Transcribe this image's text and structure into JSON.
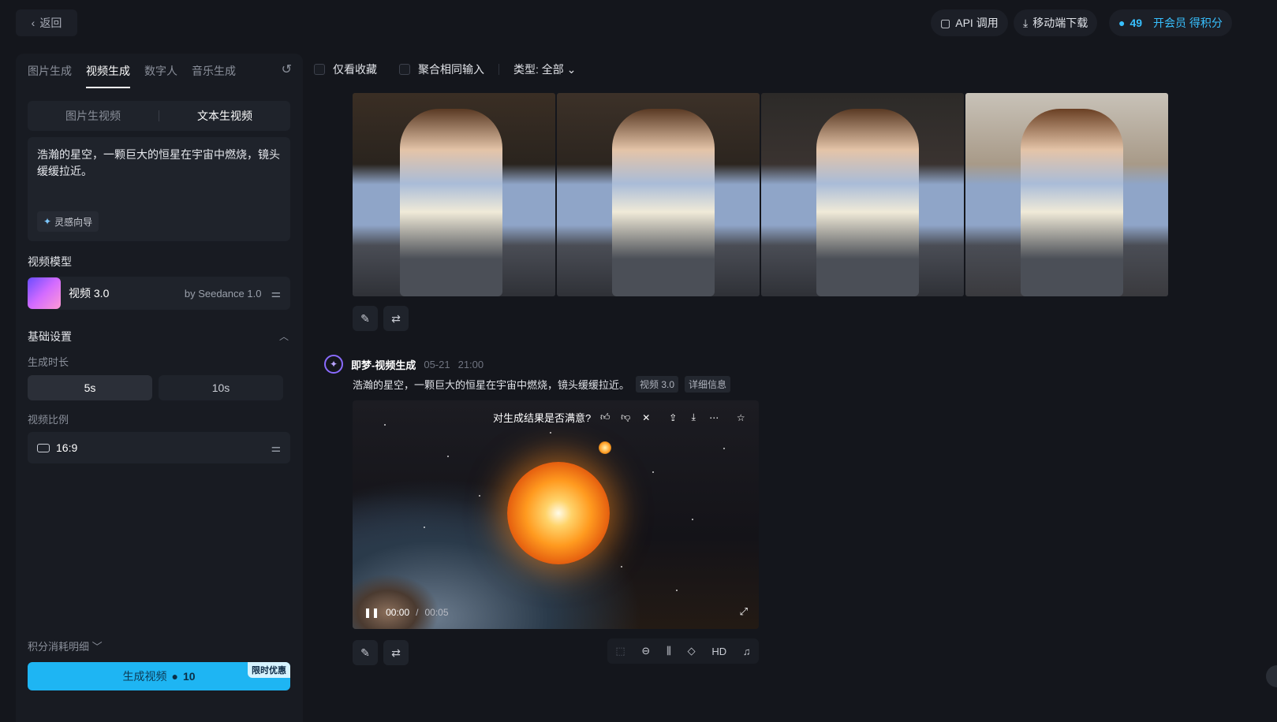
{
  "topbar": {
    "back_label": "返回",
    "api_label": "API 调用",
    "mobile_label": "移动端下载",
    "credits": "49",
    "vip_label": "开会员 得积分"
  },
  "left": {
    "tabs": [
      {
        "label": "图片生成"
      },
      {
        "label": "视频生成",
        "active": true
      },
      {
        "label": "数字人"
      },
      {
        "label": "音乐生成"
      }
    ],
    "mode": {
      "image_to_video": "图片生视频",
      "text_to_video": "文本生视频"
    },
    "prompt": "浩瀚的星空，一颗巨大的恒星在宇宙中燃烧，镜头缓缓拉近。",
    "inspire_label": "灵感向导",
    "model_section": "视频模型",
    "model_name": "视频 3.0",
    "model_by": "by Seedance 1.0",
    "basic_settings": "基础设置",
    "duration_label": "生成时长",
    "durations": [
      "5s",
      "10s"
    ],
    "ratio_label": "视频比例",
    "ratio_value": "16:9",
    "cost_detail": "积分消耗明细",
    "generate_label": "生成视频",
    "generate_cost": "10",
    "promo_badge": "限时优惠"
  },
  "filters": {
    "favorites_only": "仅看收藏",
    "merge_same": "聚合相同输入",
    "type_label": "类型: 全部"
  },
  "generation": {
    "name": "即梦-视频生成",
    "date": "05-21",
    "time": "21:00",
    "prompt": "浩瀚的星空，一颗巨大的恒星在宇宙中燃烧，镜头缓缓拉近。",
    "model_tag": "视频 3.0",
    "detail_tag": "详细信息",
    "feedback_question": "对生成结果是否满意?",
    "current_time": "00:00",
    "total_time": "00:05",
    "hd_label": "HD"
  }
}
